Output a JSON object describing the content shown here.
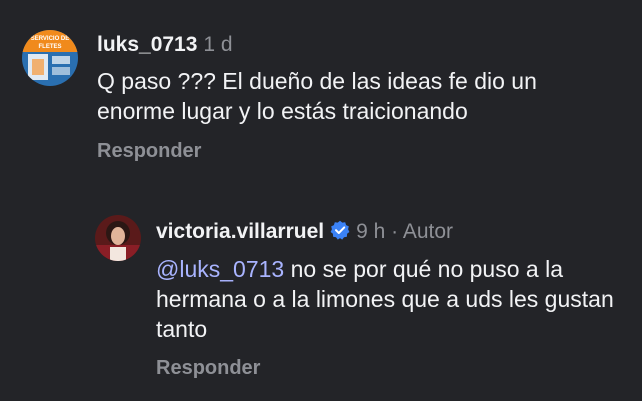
{
  "comments": [
    {
      "username": "luks_0713",
      "time": "1 d",
      "text": "Q paso ??? El dueño de las ideas fe dio un enorme lugar y lo estás traicionando",
      "reply_label": "Responder",
      "avatar": {
        "text_line1": "SERVICIO DE",
        "text_line2": "FLETES",
        "colors": [
          "#f08a1c",
          "#2a6fb0",
          "#ffffff"
        ]
      }
    },
    {
      "username": "victoria.villarruel",
      "verified": true,
      "time": "9 h",
      "separator": "·",
      "author_label": "Autor",
      "mention": "@luks_0713",
      "text": "no se por qué no puso a la hermana o a la limones que a uds les gustan tanto",
      "reply_label": "Responder"
    }
  ],
  "colors": {
    "background": "#232428",
    "text": "#f2f3f5",
    "muted": "#8e9096",
    "mention": "#a9b4ff",
    "verified": "#3b82f6"
  }
}
